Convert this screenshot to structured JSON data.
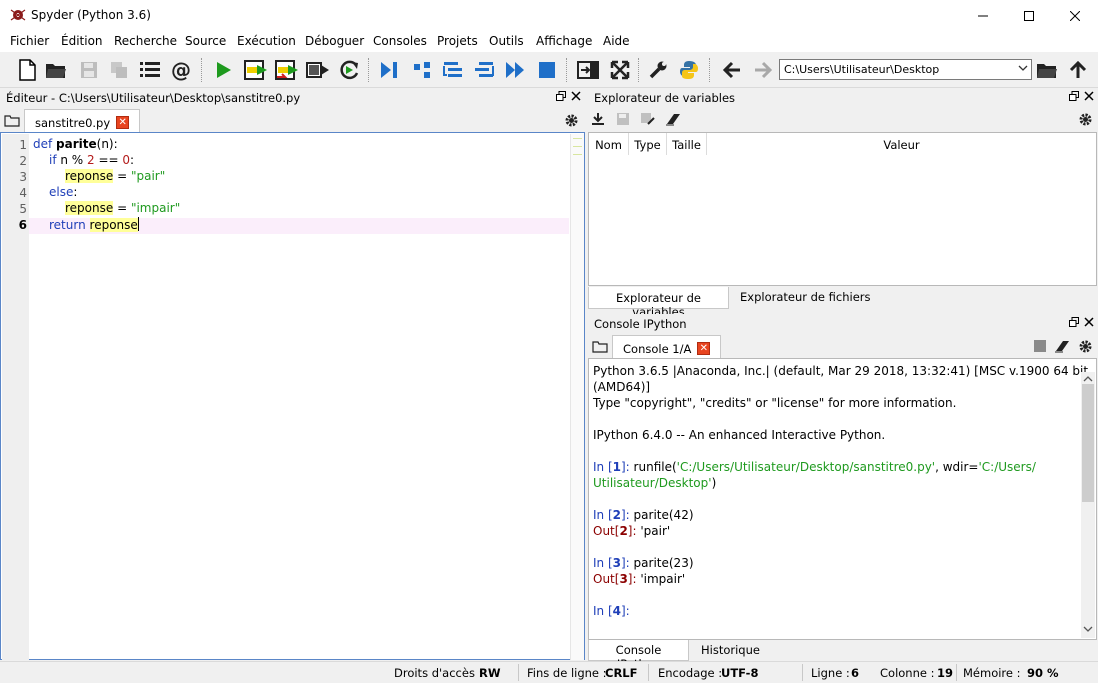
{
  "window": {
    "title": "Spyder (Python 3.6)"
  },
  "menu": [
    "Fichier",
    "Édition",
    "Recherche",
    "Source",
    "Exécution",
    "Déboguer",
    "Consoles",
    "Projets",
    "Outils",
    "Affichage",
    "Aide"
  ],
  "toolbar": {
    "path": "C:\\Users\\Utilisateur\\Desktop"
  },
  "editor": {
    "title": "Éditeur - C:\\Users\\Utilisateur\\Desktop\\sanstitre0.py",
    "tab": "sanstitre0.py",
    "line_numbers": [
      "1",
      "2",
      "3",
      "4",
      "5",
      "6"
    ],
    "code": {
      "l1": {
        "def": "def ",
        "name": "parite",
        "rest": "(n):"
      },
      "l2": {
        "if": "if",
        "mid": " n % ",
        "n2": "2",
        "eq": " == ",
        "n0": "0",
        "colon": ":"
      },
      "l3": {
        "var": "reponse",
        "eq": " = ",
        "str": "\"pair\""
      },
      "l4": {
        "else": "else",
        "colon": ":"
      },
      "l5": {
        "var": "reponse",
        "eq": " = ",
        "str": "\"impair\""
      },
      "l6": {
        "ret": "return",
        "sp": " ",
        "var": "reponse"
      }
    }
  },
  "varexp": {
    "title": "Explorateur de variables",
    "columns": [
      "Nom",
      "Type",
      "Taille",
      "Valeur"
    ],
    "tabs": [
      "Explorateur de variables",
      "Explorateur de fichiers"
    ]
  },
  "console": {
    "title": "Console IPython",
    "tab": "Console 1/A",
    "banner1": "Python 3.6.5 |Anaconda, Inc.| (default, Mar 29 2018, 13:32:41) [MSC v.1900 64 bit",
    "banner2": "(AMD64)]",
    "banner3": "Type \"copyright\", \"credits\" or \"license\" for more information.",
    "banner4": "IPython 6.4.0 -- An enhanced Interactive Python.",
    "in1_pre": "In [",
    "n1": "1",
    "in_post": "]: ",
    "runfile": "runfile(",
    "arg1": "'C:/Users/Utilisateur/Desktop/sanstitre0.py'",
    "wdir": ", wdir=",
    "arg2a": "'C:/Users/",
    "arg2b": "Utilisateur/Desktop'",
    "close_paren": ")",
    "n2": "2",
    "cmd2": "parite(42)",
    "out_pre": "Out[",
    "out2": "'pair'",
    "n3": "3",
    "cmd3": "parite(23)",
    "out3": "'impair'",
    "n4": "4",
    "in4_post": "]:",
    "tabs": [
      "Console IPython",
      "Historique"
    ]
  },
  "status": {
    "perm_label": "Droits d'accès :",
    "perm": "RW",
    "eol_label": "Fins de ligne :",
    "eol": "CRLF",
    "enc_label": "Encodage :",
    "enc": "UTF-8",
    "line_label": "Ligne :",
    "line": "6",
    "col_label": "Colonne :",
    "col": "19",
    "mem_label": "Mémoire :",
    "mem": "90 %"
  }
}
